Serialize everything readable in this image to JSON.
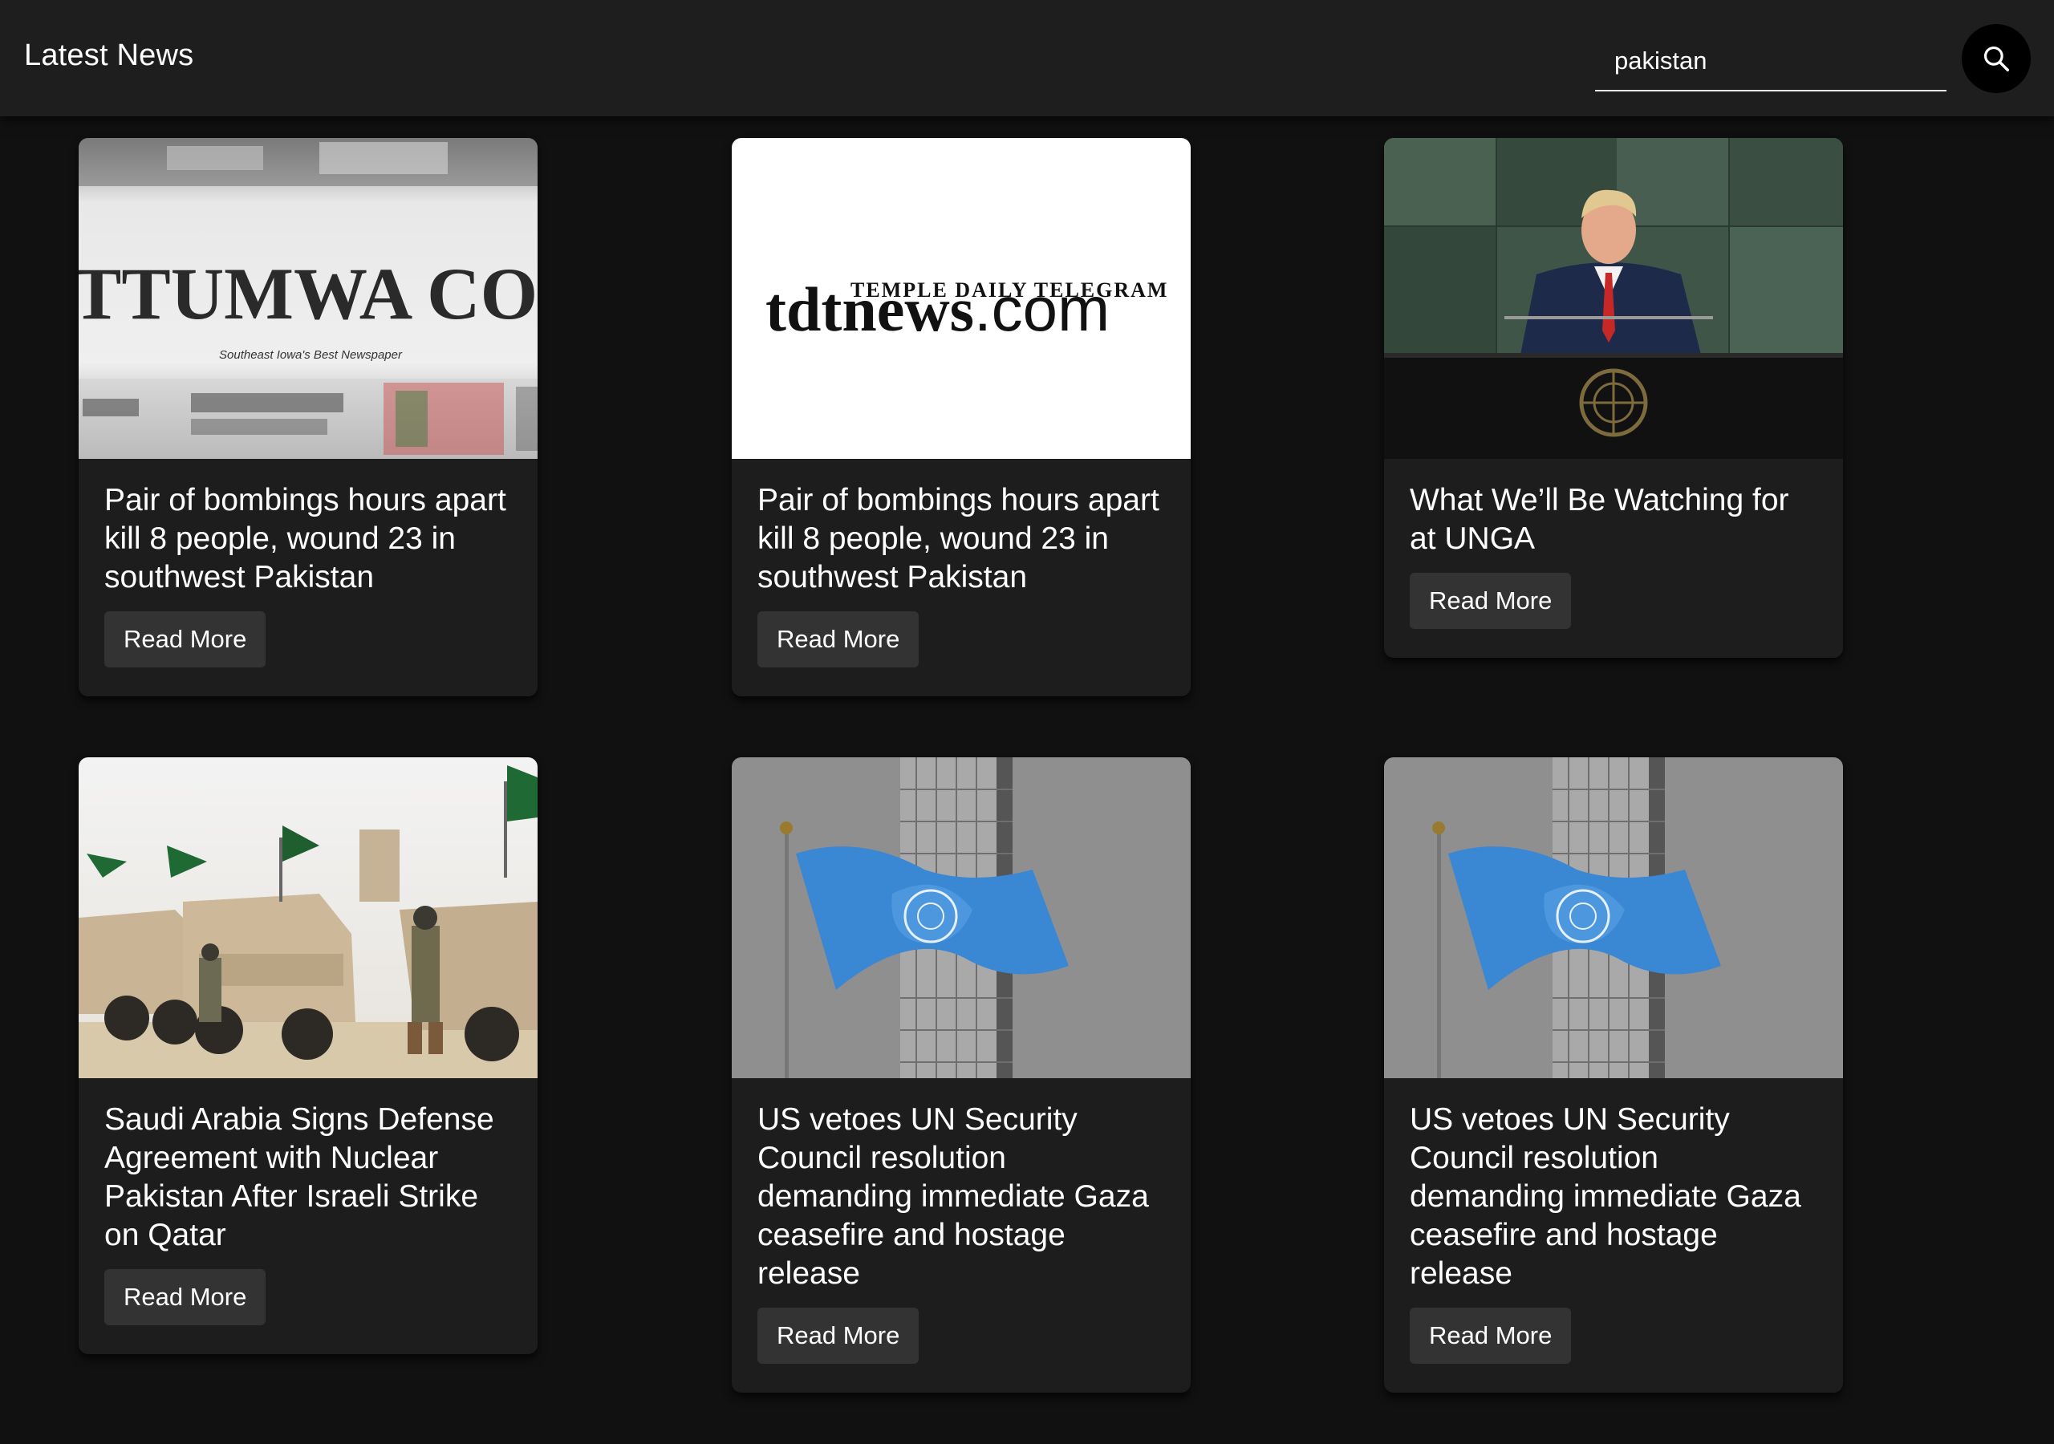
{
  "header": {
    "title": "Latest News",
    "search": {
      "value": "pakistan",
      "placeholder": ""
    },
    "search_icon": "search-icon"
  },
  "articles": [
    {
      "title": "Pair of bombings hours apart kill 8 people, wound 23 in southwest Pakistan",
      "button": "Read More",
      "image": "newspaper-masthead",
      "image_text": {
        "masthead": "TTUMWA COURI",
        "tagline": "Southeast Iowa's Best Newspaper"
      }
    },
    {
      "title": "Pair of bombings hours apart kill 8 people, wound 23 in southwest Pakistan",
      "button": "Read More",
      "image": "tdtnews-logo",
      "image_text": {
        "small": "TEMPLE DAILY TELEGRAM",
        "big": "tdtnews",
        "suffix": ".com"
      }
    },
    {
      "title": "What We’ll Be Watching for at UNGA",
      "button": "Read More",
      "image": "speaker-at-un-podium"
    },
    {
      "title": "Saudi Arabia Signs Defense Agreement with Nuclear Pakistan After Israeli Strike on Qatar",
      "button": "Read More",
      "image": "military-vehicles-with-flags"
    },
    {
      "title": "US vetoes UN Security Council resolution demanding immediate Gaza ceasefire and hostage release",
      "button": "Read More",
      "image": "un-flag"
    },
    {
      "title": "US vetoes UN Security Council resolution demanding immediate Gaza ceasefire and hostage release",
      "button": "Read More",
      "image": "un-flag"
    }
  ]
}
